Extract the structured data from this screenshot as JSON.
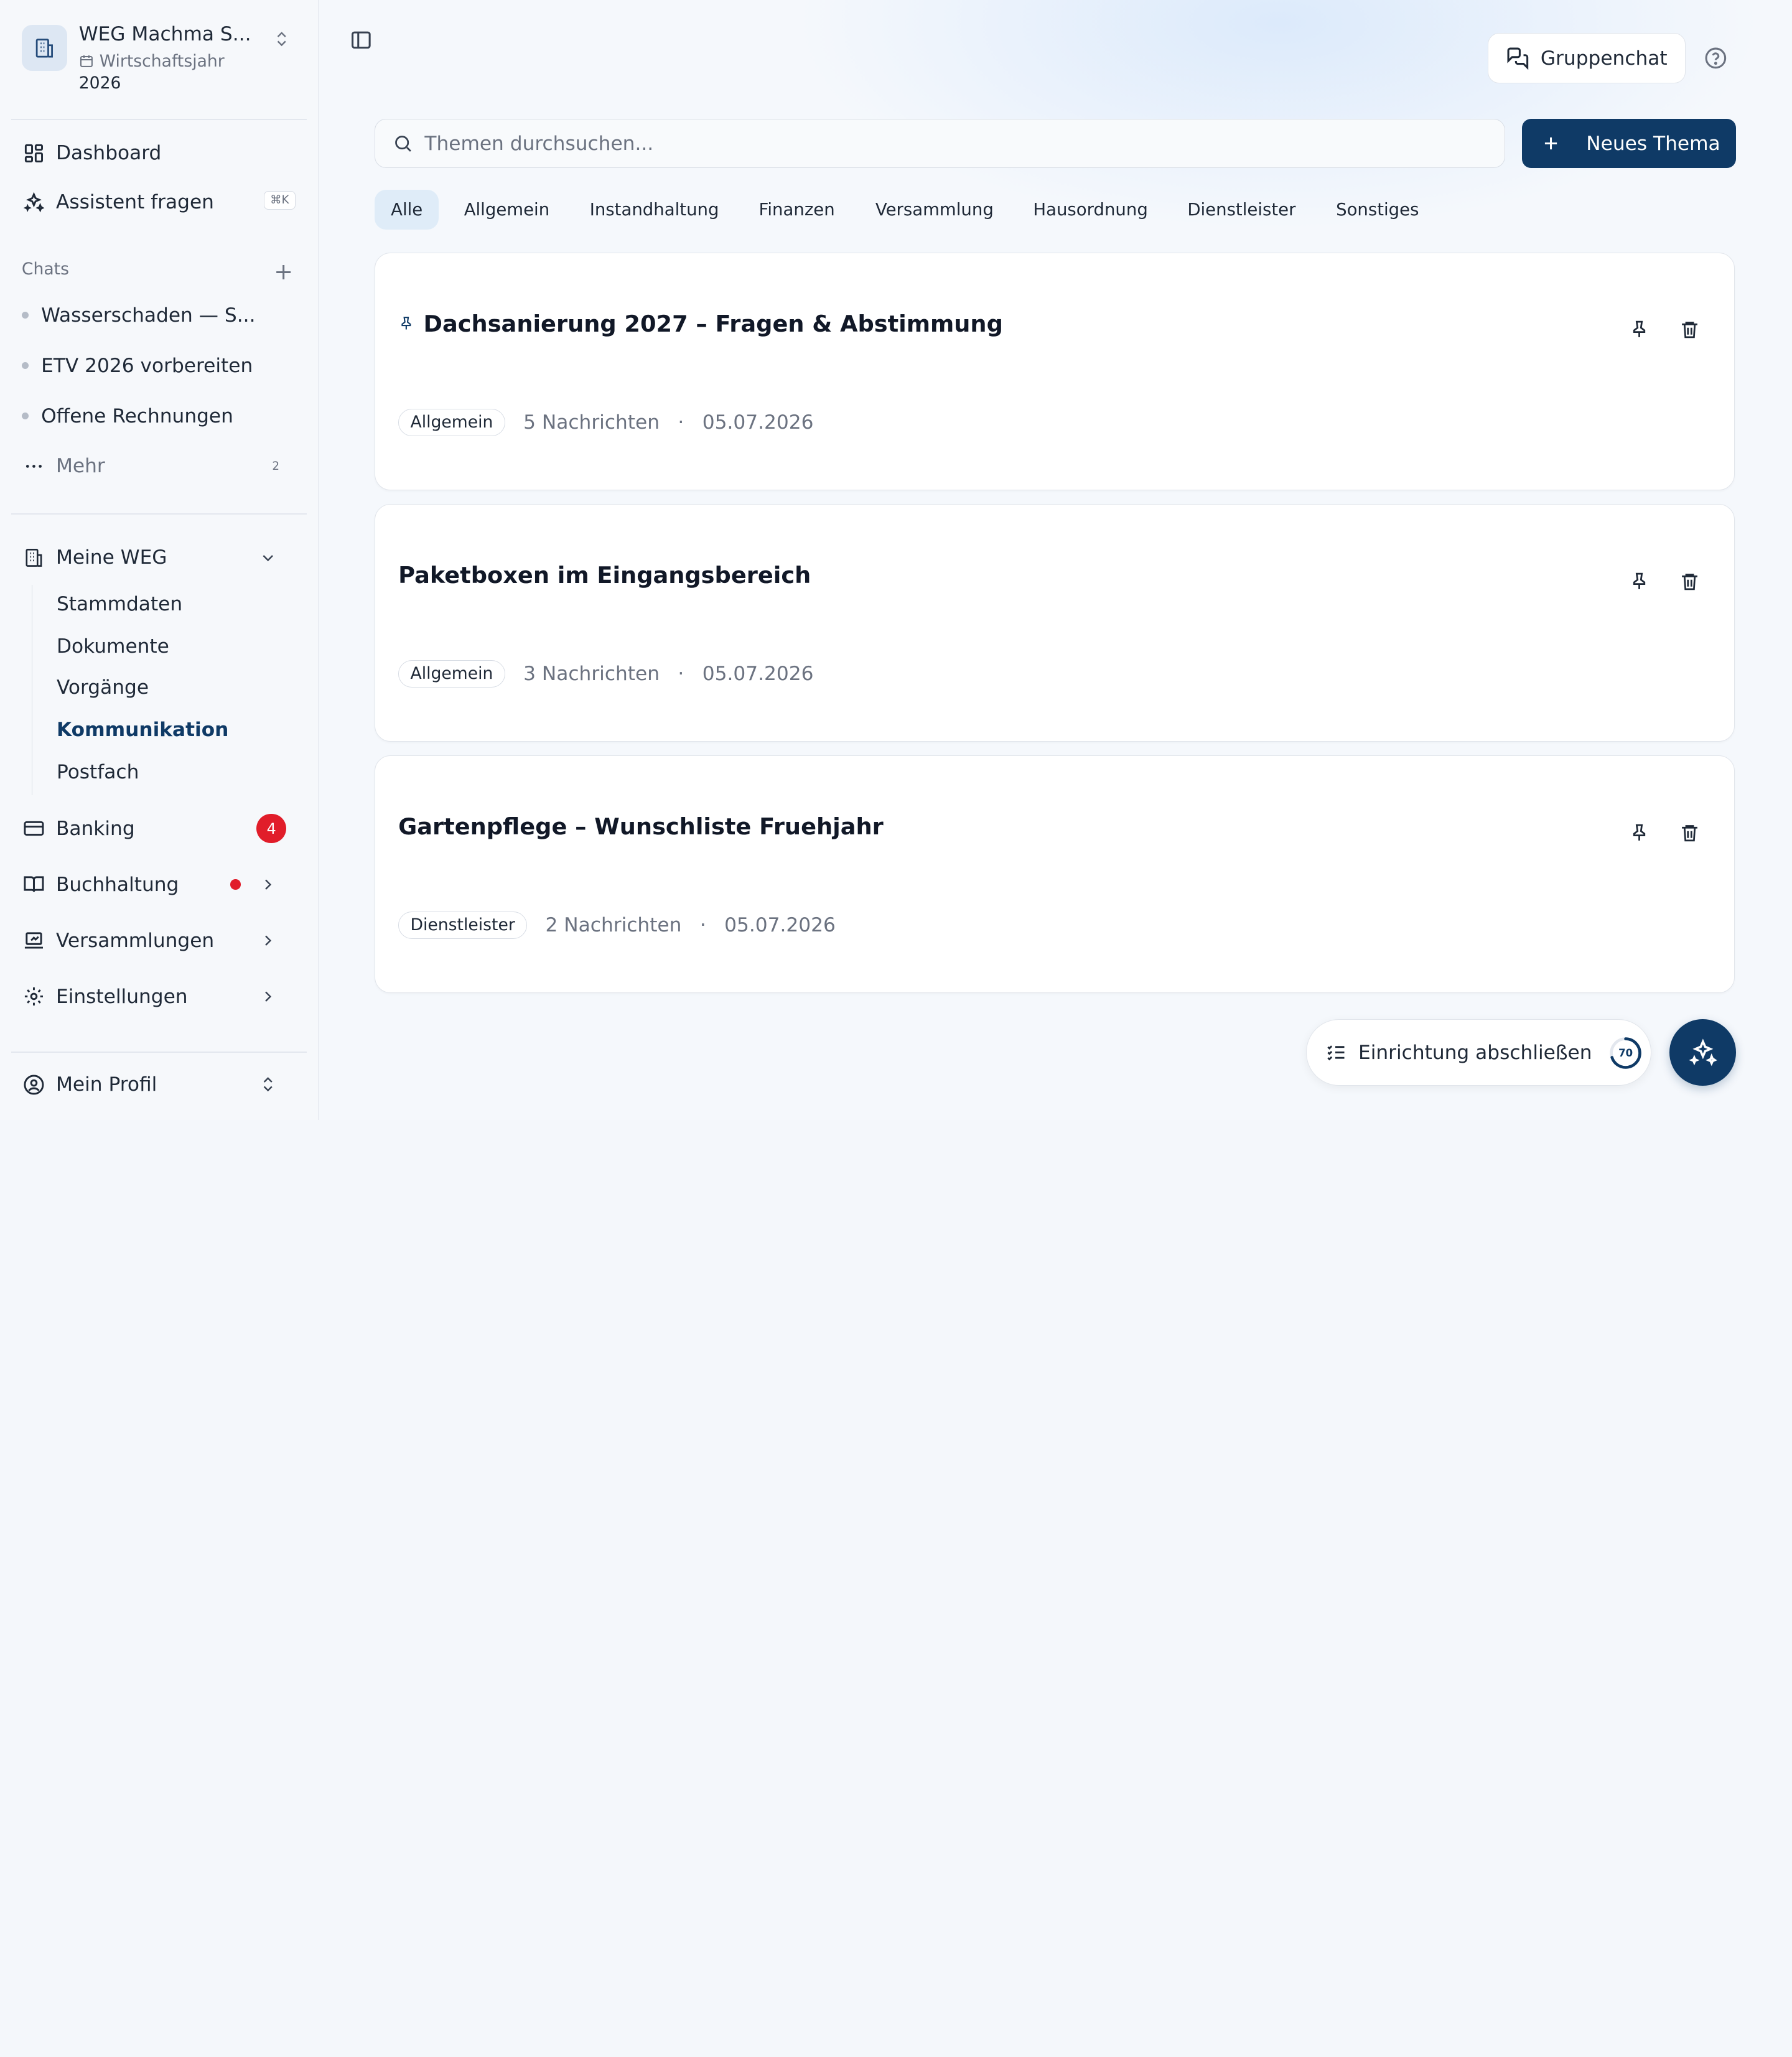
{
  "org": {
    "name": "WEG Machma S...",
    "fiscal_label": "Wirtschaftsjahr",
    "fiscal_year": "2026"
  },
  "nav": {
    "dashboard": "Dashboard",
    "assistant": "Assistent fragen",
    "assistant_shortcut": "⌘K"
  },
  "chats": {
    "label": "Chats",
    "items": [
      "Wasserschaden — S...",
      "ETV 2026 vorbereiten",
      "Offene Rechnungen"
    ],
    "more_label": "Mehr",
    "more_count": "2"
  },
  "my_weg": {
    "label": "Meine WEG",
    "items": [
      "Stammdaten",
      "Dokumente",
      "Vorgänge",
      "Kommunikation",
      "Postfach"
    ],
    "active": "Kommunikation"
  },
  "banking": {
    "label": "Banking",
    "badge": "4"
  },
  "accounting": {
    "label": "Buchhaltung"
  },
  "meetings": {
    "label": "Versammlungen"
  },
  "settings": {
    "label": "Einstellungen"
  },
  "profile": {
    "label": "Mein Profil"
  },
  "header": {
    "groupchat_label": "Gruppenchat"
  },
  "search": {
    "placeholder": "Themen durchsuchen...",
    "value": ""
  },
  "new_topic_label": "Neues Thema",
  "filters": [
    "Alle",
    "Allgemein",
    "Instandhaltung",
    "Finanzen",
    "Versammlung",
    "Hausordnung",
    "Dienstleister",
    "Sonstiges"
  ],
  "active_filter": "Alle",
  "topics": [
    {
      "title": "Dachsanierung 2027 – Fragen & Abstimmung",
      "pinned": true,
      "tag": "Allgemein",
      "messages": "5 Nachrichten",
      "date": "05.07.2026"
    },
    {
      "title": "Paketboxen im Eingangsbereich",
      "pinned": false,
      "tag": "Allgemein",
      "messages": "3 Nachrichten",
      "date": "05.07.2026"
    },
    {
      "title": "Gartenpflege – Wunschliste Fruehjahr",
      "pinned": false,
      "tag": "Dienstleister",
      "messages": "2 Nachrichten",
      "date": "05.07.2026"
    }
  ],
  "meta_separator": "·",
  "setup": {
    "label": "Einrichtung abschließen",
    "progress": 70
  },
  "colors": {
    "accent": "#0f3a66",
    "badge": "#e11d2a",
    "active_filter_bg": "#dfecf8"
  }
}
